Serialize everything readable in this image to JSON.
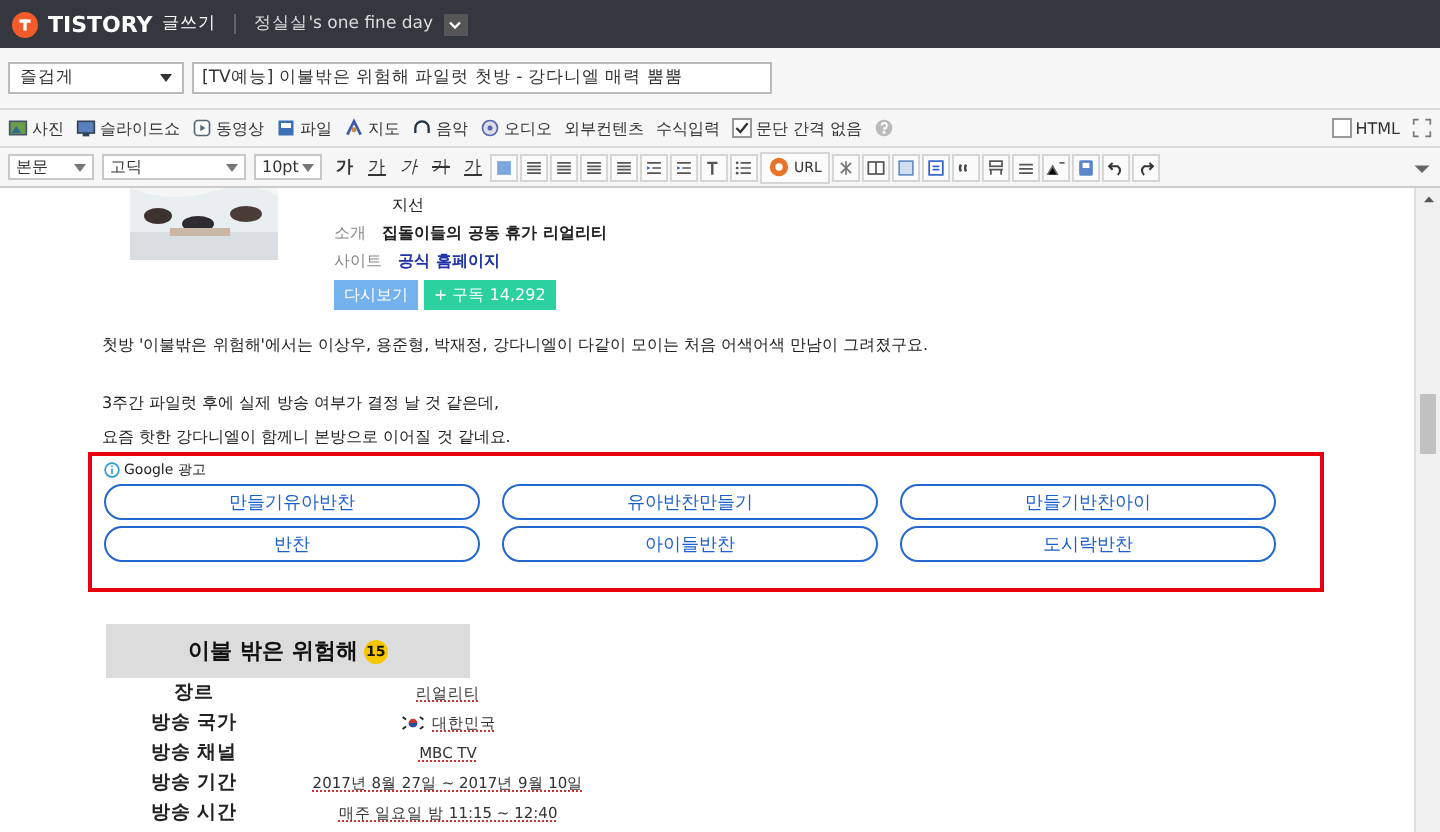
{
  "topbar": {
    "brand": "TISTORY",
    "mode": "글쓰기",
    "blog": "정실실's one fine day"
  },
  "post": {
    "category": "즐겁게",
    "title": "[TV예능] 이불밖은 위험해 파일럿 첫방 - 강다니엘 매력 뿜뿜"
  },
  "insert_toolbar": {
    "items": [
      {
        "label": "사진"
      },
      {
        "kind": "slideshow",
        "label": "슬라이드쇼"
      },
      {
        "kind": "video",
        "label": "동영상"
      },
      {
        "kind": "file",
        "label": "파일"
      },
      {
        "kind": "map",
        "label": "지도"
      },
      {
        "kind": "music",
        "label": "음악"
      },
      {
        "kind": "audio",
        "label": "오디오"
      },
      {
        "kind": "text",
        "label": "외부컨텐츠"
      },
      {
        "kind": "text",
        "label": "수식입력"
      }
    ],
    "paragraph_spacing": {
      "label": "문단 간격 없음",
      "checked": true
    },
    "html": {
      "label": "HTML",
      "checked": false
    }
  },
  "format_toolbar": {
    "paragraph_style": "본문",
    "font": "고딕",
    "size": "10pt",
    "text_buttons": [
      {
        "kind": "bold",
        "label": "가"
      },
      {
        "kind": "underline",
        "label": "가"
      },
      {
        "kind": "italic",
        "label": "가"
      },
      {
        "kind": "strike",
        "label": "가"
      },
      {
        "kind": "color",
        "label": "가"
      }
    ],
    "link_label": "URL"
  },
  "editor": {
    "program_card": {
      "cast_tail": "지선",
      "intro_label": "소개",
      "intro": "집돌이들의 공동 휴가 리얼리티",
      "site_label": "사이트",
      "site": "공식 홈페이지",
      "replay": "다시보기",
      "subscribe": "+ 구독 14,292"
    },
    "paragraphs": [
      "첫방 '이불밖은 위험해'에서는 이상우, 용준형, 박재정, 강다니엘이 다같이 모이는 처음 어색어색 만남이 그려졌구요.",
      "3주간 파일럿 후에 실제 방송 여부가 결정 날 것 같은데,",
      "요즘 핫한 강다니엘이 함께니 본방으로 이어질 것 같네요."
    ],
    "ad": {
      "label": "Google 광고",
      "keywords": [
        "만들기유아반찬",
        "유아반찬만들기",
        "만들기반찬아이",
        "반찬",
        "아이들반찬",
        "도시락반찬"
      ]
    },
    "info": {
      "title": "이불 밖은 위험해",
      "rating": "15",
      "rows": [
        {
          "label": "장르",
          "value": "리얼리티",
          "flag": false
        },
        {
          "label": "방송 국가",
          "value": "대한민국",
          "flag": true
        },
        {
          "label": "방송 채널",
          "value": "MBC TV",
          "flag": false
        },
        {
          "label": "방송 기간",
          "value": "2017년 8월 27일 ~ 2017년 9월 10일",
          "flag": false
        },
        {
          "label": "방송 시간",
          "value": "매주 일요일 밤 11:15 ~ 12:40",
          "flag": false
        }
      ]
    }
  }
}
